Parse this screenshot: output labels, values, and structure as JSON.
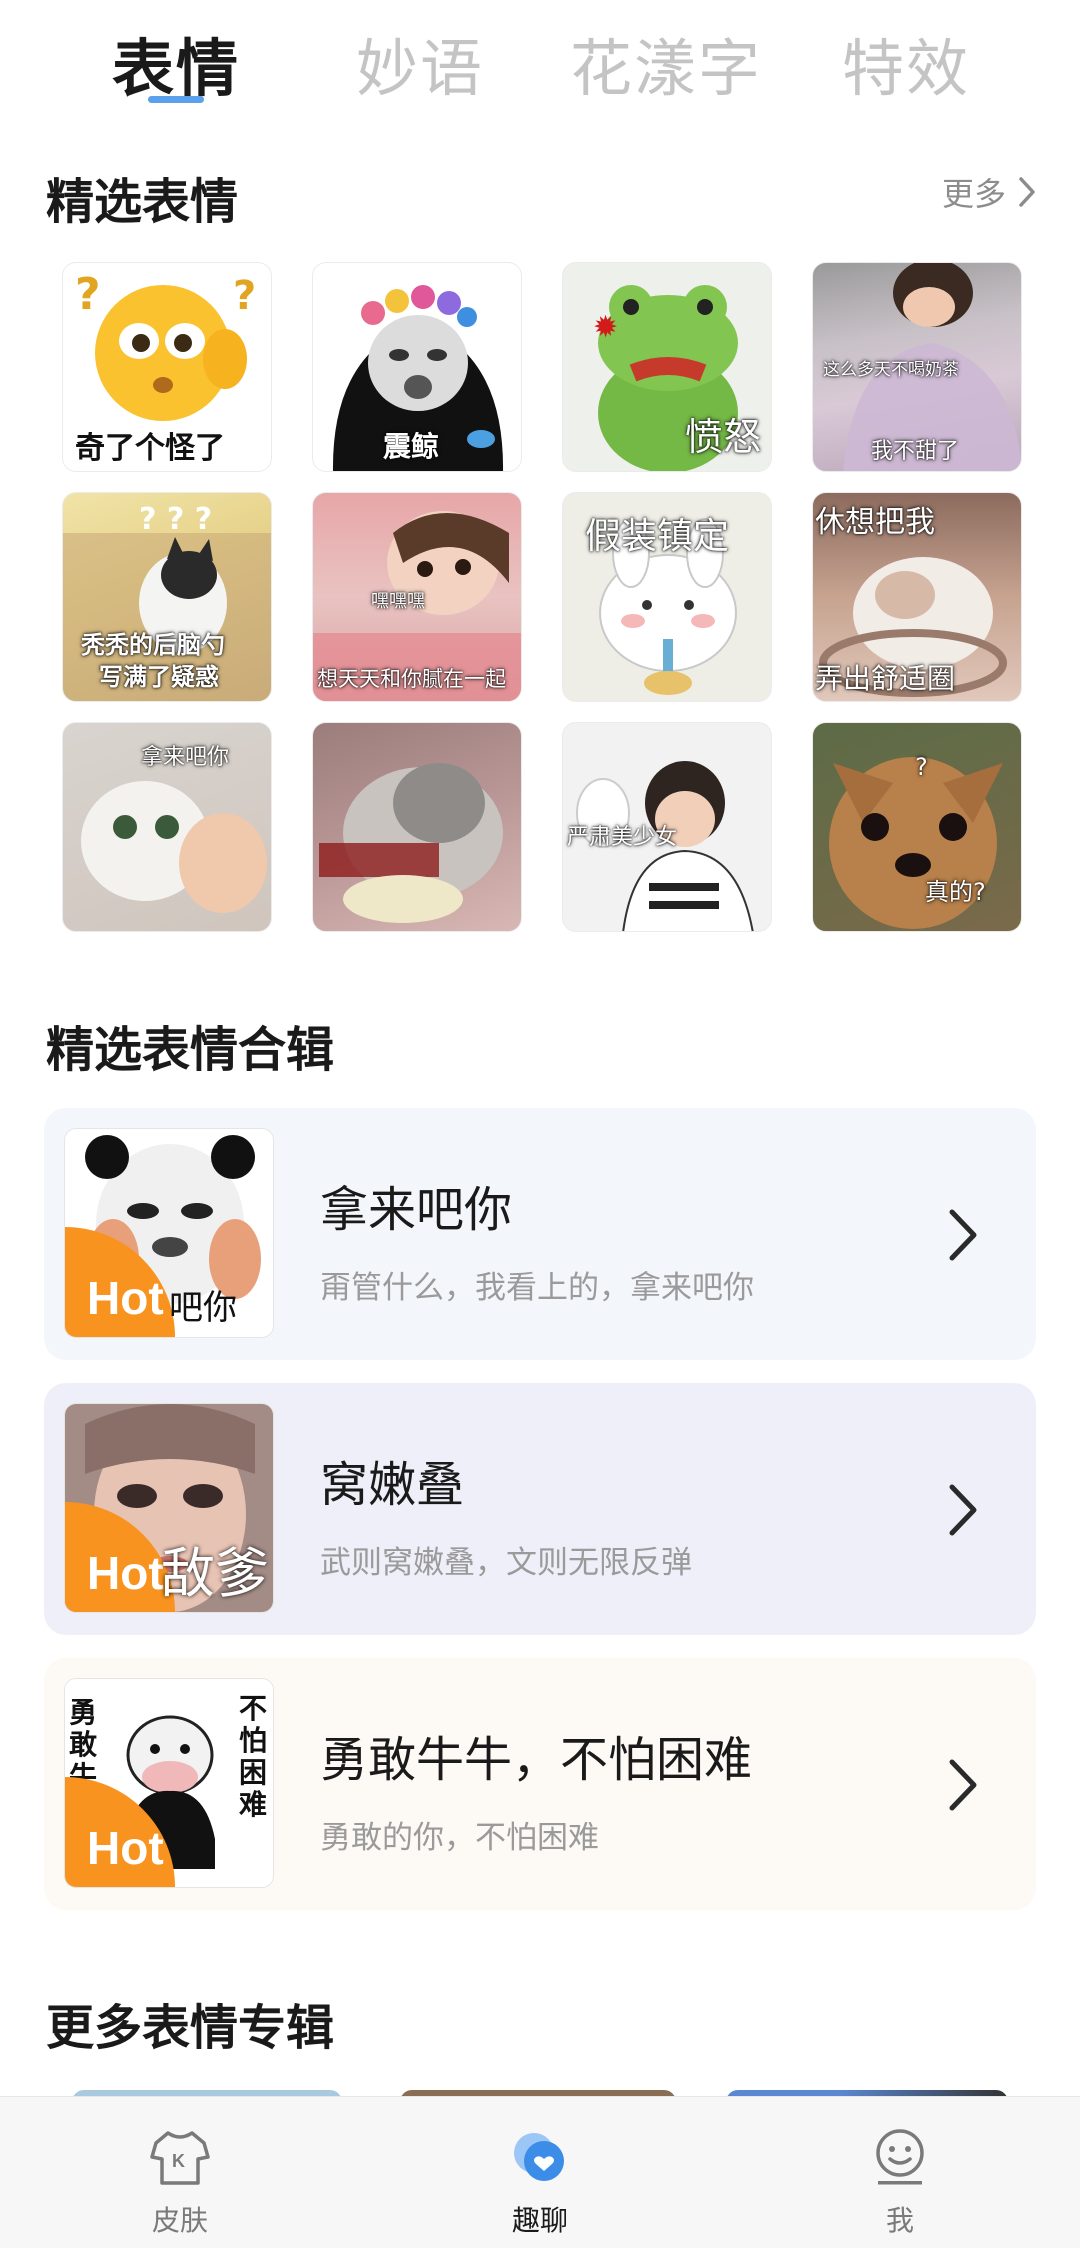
{
  "tabs": [
    {
      "label": "表情",
      "active": true
    },
    {
      "label": "妙语",
      "active": false
    },
    {
      "label": "花漾字",
      "active": false
    },
    {
      "label": "特效",
      "active": false
    }
  ],
  "featured": {
    "title": "精选表情",
    "more_label": "更多",
    "stickers": [
      {
        "caption": "奇了个怪了"
      },
      {
        "caption": "震鲸"
      },
      {
        "caption": "愤怒"
      },
      {
        "caption": "这么多天不喝奶茶",
        "caption2": "我不甜了"
      },
      {
        "caption": "秃秃的后脑勺",
        "caption2": "写满了疑惑"
      },
      {
        "caption": "嘿嘿嘿",
        "caption2": "想天天和你腻在一起"
      },
      {
        "caption": "假装镇定"
      },
      {
        "caption": "休想把我",
        "caption2": "弄出舒适圈"
      },
      {
        "caption": "拿来吧你"
      },
      {
        "caption": ""
      },
      {
        "caption": "严肃美少女"
      },
      {
        "caption": "?",
        "caption2": "真的?"
      }
    ]
  },
  "albums_section": {
    "title": "精选表情合辑",
    "albums": [
      {
        "title": "拿来吧你",
        "desc": "甭管什么，我看上的，拿来吧你",
        "badge": "Hot",
        "thumb_text": "吧你",
        "bg": "#f3f6fb"
      },
      {
        "title": "窝嫩叠",
        "desc": "武则窝嫩叠，文则无限反弹",
        "badge": "Hot",
        "thumb_text": "敌爹",
        "bg": "#efeff9"
      },
      {
        "title": "勇敢牛牛，不怕困难",
        "desc": "勇敢的你，不怕困难",
        "badge": "Hot",
        "thumb_text_left": "勇敢牛",
        "thumb_text_right": "不怕困难",
        "bg": "#fdfaf5"
      }
    ]
  },
  "more_albums": {
    "title": "更多表情专辑"
  },
  "bottom_nav": [
    {
      "label": "皮肤",
      "icon": "shirt-icon",
      "active": false
    },
    {
      "label": "趣聊",
      "icon": "chat-bubble-icon",
      "active": true
    },
    {
      "label": "我",
      "icon": "smiley-icon",
      "active": false
    }
  ],
  "colors": {
    "accent": "#5aa0ea",
    "hot_badge": "#f7931e"
  }
}
